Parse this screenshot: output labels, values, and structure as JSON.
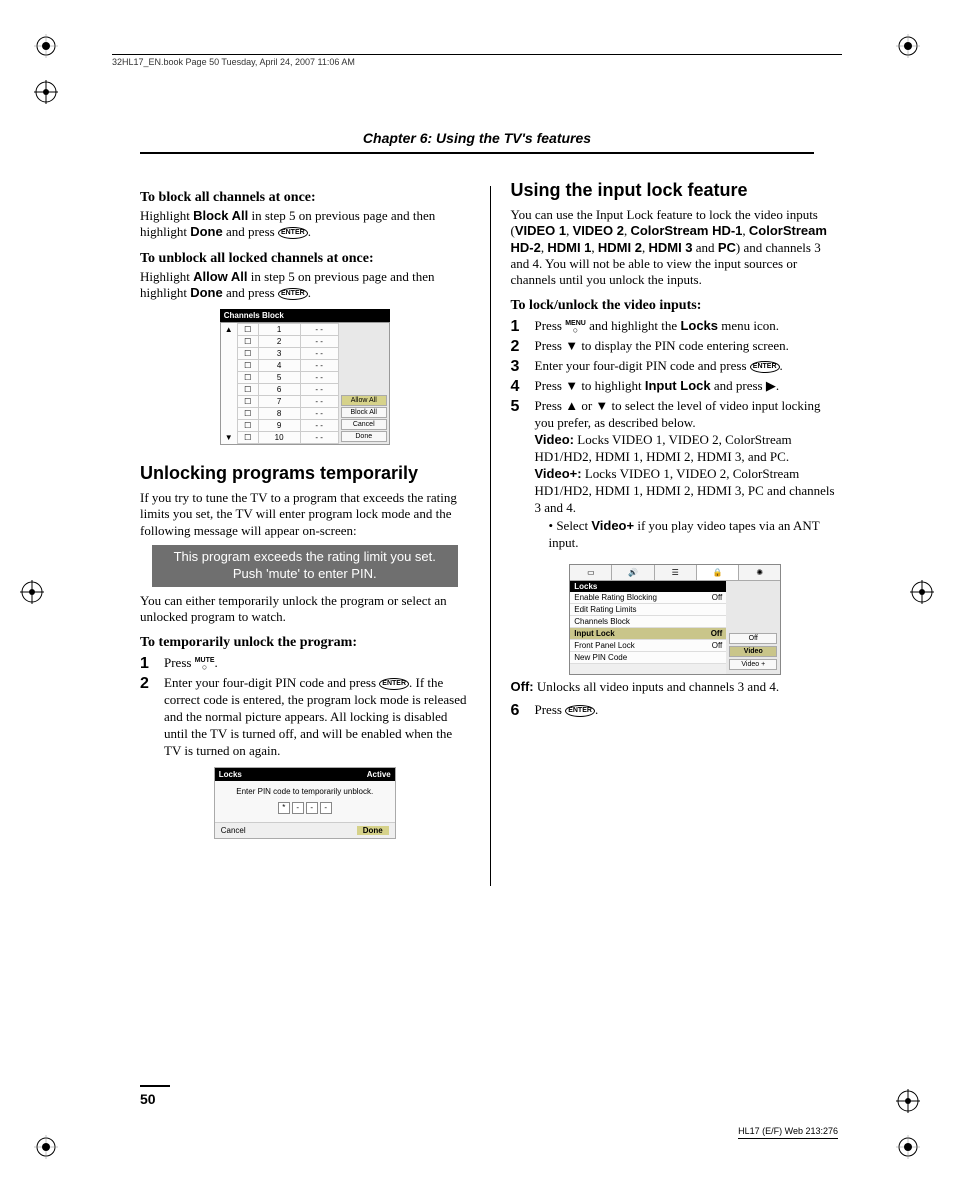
{
  "header": {
    "book_info": "32HL17_EN.book  Page 50  Tuesday, April 24, 2007  11:06 AM"
  },
  "chapter": "Chapter 6: Using the TV's features",
  "left": {
    "h_block_all": "To block all channels at once:",
    "p_block_all_a": "Highlight ",
    "p_block_all_b": "Block All",
    "p_block_all_c": " in step 5 on previous page and then highlight ",
    "p_block_all_d": "Done",
    "p_block_all_e": " and press ",
    "enter_label": "ENTER",
    "h_unblock_all": "To unblock all locked channels at once:",
    "p_unblock_a": "Highlight ",
    "p_unblock_b": "Allow All",
    "p_unblock_c": " in step 5 on previous page and then highlight ",
    "p_unblock_d": "Done",
    "p_unblock_e": " and press ",
    "channels_block": {
      "title": "Channels Block",
      "rows": [
        {
          "n": "1",
          "v": "- -"
        },
        {
          "n": "2",
          "v": "- -"
        },
        {
          "n": "3",
          "v": "- -"
        },
        {
          "n": "4",
          "v": "- -"
        },
        {
          "n": "5",
          "v": "- -"
        },
        {
          "n": "6",
          "v": "- -"
        },
        {
          "n": "7",
          "v": "- -"
        },
        {
          "n": "8",
          "v": "- -"
        },
        {
          "n": "9",
          "v": "- -"
        },
        {
          "n": "10",
          "v": "- -"
        }
      ],
      "buttons": {
        "allow": "Allow All",
        "block": "Block All",
        "cancel": "Cancel",
        "done": "Done"
      }
    },
    "h_unlock_temp": "Unlocking programs temporarily",
    "p_unlock_desc": "If you try to tune the TV to a program that exceeds the rating limits you set, the TV will enter program lock mode and the following message will appear on-screen:",
    "msg_line1": "This program exceeds the rating limit you set.",
    "msg_line2": "Push 'mute' to enter PIN.",
    "p_options": "You can either temporarily unlock the program or select an unlocked program to watch.",
    "h_temp_unlock": "To temporarily unlock the program:",
    "step1_a": "Press ",
    "mute_label": "MUTE",
    "step1_b": ".",
    "step2_a": "Enter your four-digit PIN code and press ",
    "step2_b": ". If the correct code is entered, the program lock mode is released and the normal picture appears. All locking is disabled until the TV is turned off, and will be enabled when the TV is turned on again.",
    "locks_pin": {
      "title": "Locks",
      "status": "Active",
      "msg": "Enter PIN code to temporarily unblock.",
      "cancel": "Cancel",
      "done": "Done"
    }
  },
  "right": {
    "h_input_lock": "Using the input lock feature",
    "p_intro_a": "You can use the Input Lock feature to lock the video inputs (",
    "inputs": {
      "v1": "VIDEO 1",
      "v2": "VIDEO 2",
      "cs1": "ColorStream HD-1",
      "cs2": "ColorStream HD-2",
      "h1": "HDMI 1",
      "h2": "HDMI 2",
      "h3": "HDMI 3",
      "pc": "PC"
    },
    "p_intro_b": ") and channels 3 and 4. You will not be able to view the input sources or channels until you unlock the inputs.",
    "h_lock_unlock": "To lock/unlock the video inputs:",
    "s1_a": "Press ",
    "menu_label": "MENU",
    "s1_b": " and highlight the ",
    "s1_c": "Locks",
    "s1_d": " menu icon.",
    "s2": "Press ▼ to display the PIN code entering screen.",
    "s3_a": "Enter your four-digit PIN code and press ",
    "s3_b": ".",
    "s4_a": "Press ▼ to highlight ",
    "s4_b": "Input Lock",
    "s4_c": " and press ▶.",
    "s5_a": "Press ▲ or ▼ to select the level of video input locking you prefer, as described below.",
    "s5_video_label": "Video:",
    "s5_video": " Locks VIDEO 1, VIDEO 2, ColorStream HD1/HD2, HDMI 1, HDMI 2, HDMI 3, and PC.",
    "s5_videoplus_label": "Video+:",
    "s5_videoplus": " Locks VIDEO 1, VIDEO 2, ColorStream HD1/HD2, HDMI 1, HDMI 2, HDMI 3, PC and channels 3 and 4.",
    "s5_bullet_a": "Select ",
    "s5_bullet_b": "Video+",
    "s5_bullet_c": " if you play video tapes via an ANT input.",
    "locks_menu": {
      "category": "Locks",
      "items": [
        {
          "label": "Enable Rating Blocking",
          "val": "Off",
          "hl": false
        },
        {
          "label": "Edit Rating Limits",
          "val": "",
          "hl": false
        },
        {
          "label": "Channels Block",
          "val": "",
          "hl": false
        },
        {
          "label": "Input Lock",
          "val": "Off",
          "hl": true
        },
        {
          "label": "Front Panel Lock",
          "val": "Off",
          "hl": false
        },
        {
          "label": "New PIN Code",
          "val": "",
          "hl": false
        }
      ],
      "options": [
        {
          "label": "Off",
          "hl": false
        },
        {
          "label": "Video",
          "hl": true
        },
        {
          "label": "Video +",
          "hl": false
        }
      ]
    },
    "off_label": "Off:",
    "off_text": " Unlocks all video inputs and channels 3 and 4.",
    "s6_a": "Press ",
    "s6_b": "."
  },
  "footer": {
    "page": "50",
    "code": "HL17 (E/F) Web 213:276"
  }
}
